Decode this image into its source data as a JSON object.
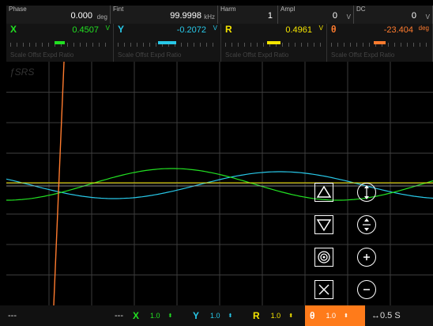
{
  "params": [
    {
      "label": "Phase",
      "value": "0.000",
      "unit": "deg"
    },
    {
      "label": "Fint",
      "value": "99.9998",
      "unit": "kHz"
    },
    {
      "label": "Harm",
      "value": "1",
      "unit": ""
    },
    {
      "label": "Ampl",
      "value": "0",
      "unit": "V"
    },
    {
      "label": "DC",
      "value": "0",
      "unit": "V"
    }
  ],
  "channels": [
    {
      "name": "X",
      "value": "0.4507",
      "unit": "V",
      "color": "#22e022",
      "footer": "Scale Offst Expd Ratio",
      "level": 0.52
    },
    {
      "name": "Y",
      "value": "-0.2072",
      "unit": "V",
      "color": "#28c8e8",
      "footer": "Scale Offst Expd Ratio",
      "level": 0.4
    },
    {
      "name": "R",
      "value": "0.4961",
      "unit": "V",
      "color": "#f4e400",
      "footer": "Scale Offst Expd Ratio",
      "level": 0.55
    },
    {
      "name": "θ",
      "value": "-23.404",
      "unit": "deg",
      "color": "#ff7b2e",
      "footer": "Scale Offst Expd Ratio",
      "level": 0.46
    }
  ],
  "plot": {
    "logo": "ƒSRS",
    "grid_color": "#3c3c3c",
    "icons": [
      "scale-up-icon",
      "scale-down-icon",
      "target-icon",
      "close-icon",
      "zoom-vertical-icon",
      "zoom-vertical-expand-icon",
      "zoom-in-icon",
      "zoom-out-icon"
    ]
  },
  "bottom": {
    "left_text": "---",
    "mid_text": "---",
    "channels": [
      {
        "name": "X",
        "value": "1.0",
        "color": "#22e022",
        "bg": "#111"
      },
      {
        "name": "Y",
        "value": "1.0",
        "color": "#28c8e8",
        "bg": "#111"
      },
      {
        "name": "R",
        "value": "1.0",
        "color": "#f4e400",
        "bg": "#111"
      },
      {
        "name": "θ",
        "value": "1.0",
        "color": "#ffffff",
        "bg": "#ff7b1a"
      }
    ],
    "arrow": "⬍",
    "time": "↔0.5 S"
  }
}
